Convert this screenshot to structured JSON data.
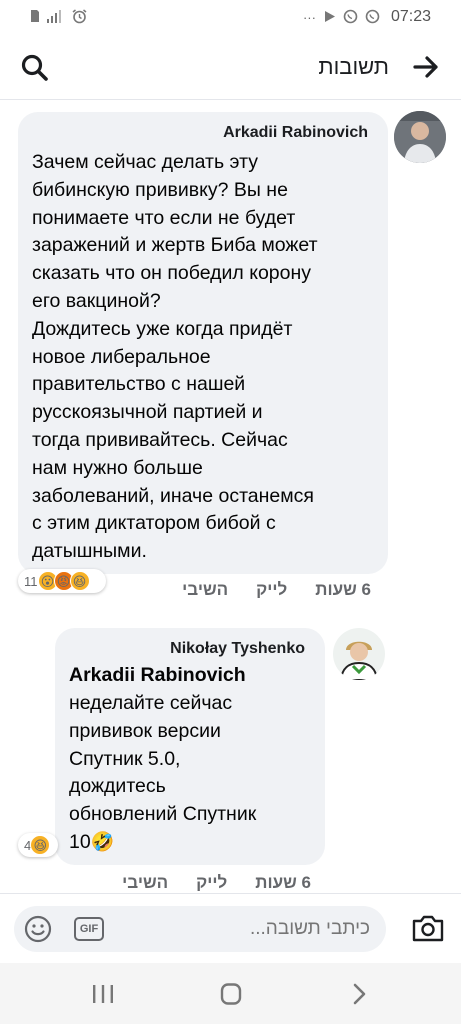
{
  "status_bar": {
    "left_icons": [
      "sim-icon",
      "signal-icon",
      "alarm-icon"
    ],
    "right_icons": [
      "more-icon",
      "play-icon",
      "whatsapp-icon",
      "whatsapp-icon"
    ],
    "dots": "···",
    "time": "07:23"
  },
  "header": {
    "title": "תשובות"
  },
  "comments": [
    {
      "author": "Arkadii Rabinovich",
      "text": "Зачем сейчас делать эту\nбибинскую прививку? Вы не\nпонимаете что если не будет\nзаражений и жертв Биба может\nсказать что он победил корону\nего вакциной?\nДождитесь уже когда придёт\nновое либеральное\nправительство с нашей\nрусскоязычной  партией и\nтогда прививайтесь. Сейчас\nнам нужно больше\nзаболеваний, иначе останемся\nс этим диктатором бибой с\nдатышными.",
      "reaction_count": "11",
      "reactions": [
        "wow",
        "angry",
        "haha"
      ],
      "time": "6 שעות",
      "like_label": "לייק",
      "reply_label": "השיבי"
    },
    {
      "author": "Nikołay Tyshenko",
      "mention": "Arkadii Rabinovich",
      "text": "неделайте сейчас\nпрививок версии\nСпутник 5.0,\nдождитесь\nобновлений Спутник\n10",
      "emoji_suffix": "🤣",
      "reaction_count": "4",
      "reactions": [
        "haha"
      ],
      "time": "6 שעות",
      "like_label": "לייק",
      "reply_label": "השיבי"
    }
  ],
  "composer": {
    "placeholder": "כיתבי תשובה...",
    "gif_label": "GIF"
  },
  "colors": {
    "bubble": "#f0f2f5",
    "secondary_text": "#65676b",
    "primary_text": "#050505"
  }
}
